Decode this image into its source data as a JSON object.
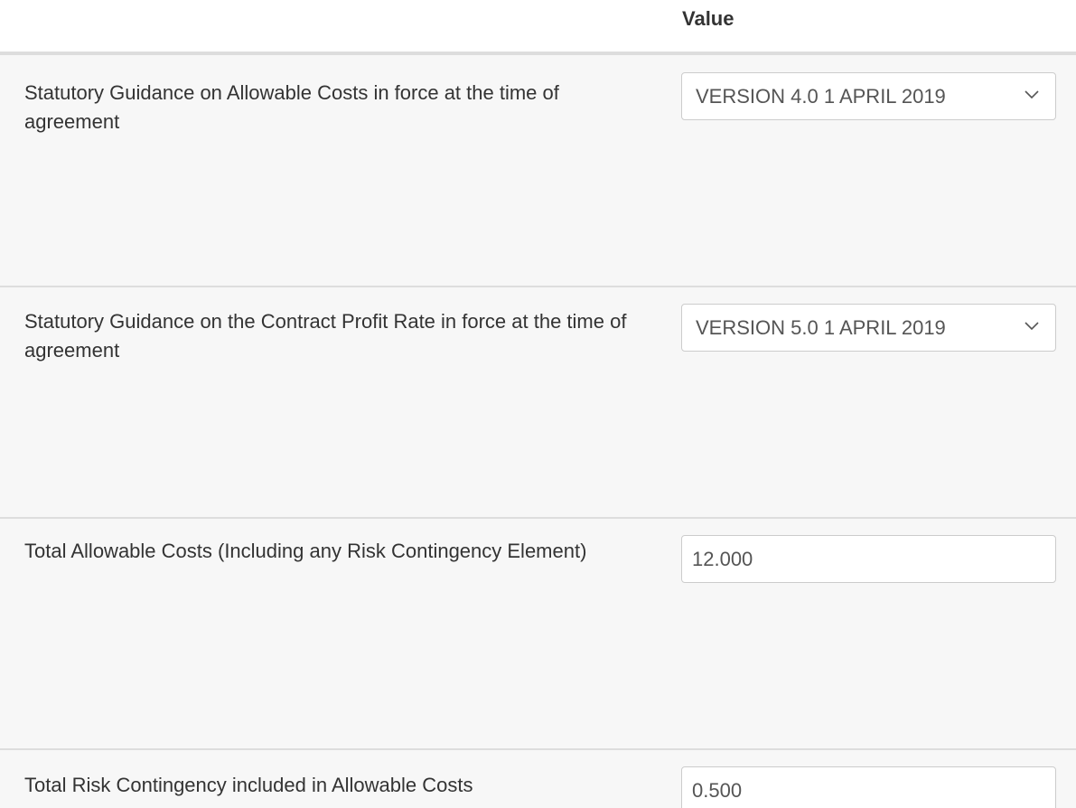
{
  "table": {
    "header": {
      "value_label": "Value"
    },
    "rows": [
      {
        "label": "Statutory Guidance on Allowable Costs in force at the time of agreement",
        "control": "select",
        "value": "VERSION 4.0 1 APRIL 2019",
        "icon": "chevron-down-icon"
      },
      {
        "label": "Statutory Guidance on the Contract Profit Rate in force at the time of agreement",
        "control": "select",
        "value": "VERSION 5.0 1 APRIL 2019",
        "icon": "chevron-down-icon"
      },
      {
        "label": "Total Allowable Costs (Including any Risk Contingency Element)",
        "control": "input",
        "value": "12.000"
      },
      {
        "label": "Total Risk Contingency included in Allowable Costs",
        "control": "input",
        "value": "0.500"
      }
    ]
  }
}
